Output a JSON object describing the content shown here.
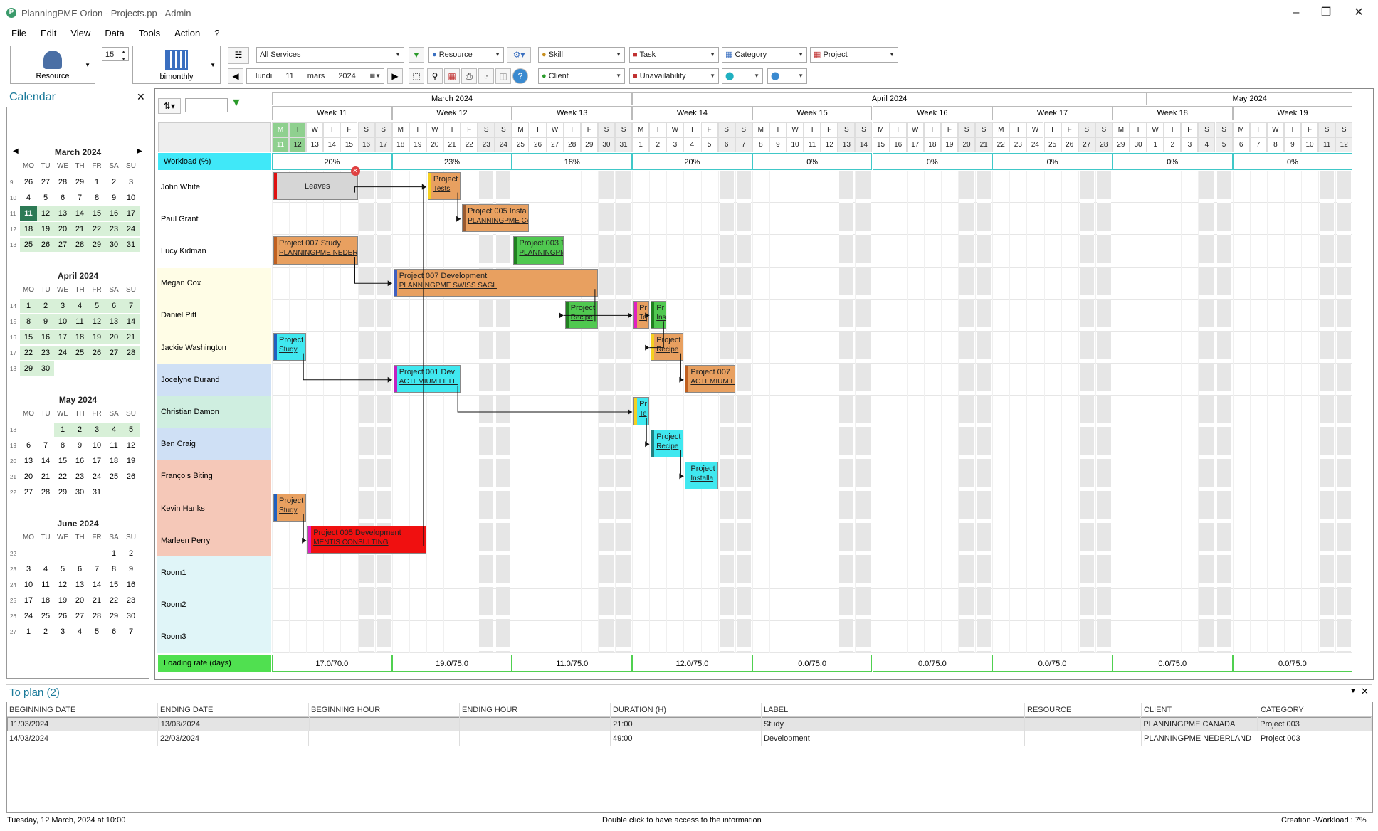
{
  "window": {
    "title": "PlanningPME Orion - Projects.pp - Admin"
  },
  "menu": [
    "File",
    "Edit",
    "View",
    "Data",
    "Tools",
    "Action",
    "?"
  ],
  "toolbar": {
    "resource_label": "Resource",
    "zoom_value": "15",
    "period_label": "bimonthly",
    "services": "All Services",
    "resource_filter": "Resource",
    "skill": "Skill",
    "task": "Task",
    "category": "Category",
    "project": "Project",
    "date_day": "lundi",
    "date_num": "11",
    "date_month": "mars",
    "date_year": "2024",
    "client": "Client",
    "unavailability": "Unavailability"
  },
  "calendar": {
    "title": "Calendar",
    "day_headers": [
      "MO",
      "TU",
      "WE",
      "TH",
      "FR",
      "SA",
      "SU"
    ],
    "months": [
      {
        "name": "March 2024",
        "weeks": [
          {
            "wk": "9",
            "days": [
              "26",
              "27",
              "28",
              "29",
              "1",
              "2",
              "3"
            ]
          },
          {
            "wk": "10",
            "days": [
              "4",
              "5",
              "6",
              "7",
              "8",
              "9",
              "10"
            ]
          },
          {
            "wk": "11",
            "days": [
              "11",
              "12",
              "13",
              "14",
              "15",
              "16",
              "17"
            ]
          },
          {
            "wk": "12",
            "days": [
              "18",
              "19",
              "20",
              "21",
              "22",
              "23",
              "24"
            ]
          },
          {
            "wk": "13",
            "days": [
              "25",
              "26",
              "27",
              "28",
              "29",
              "30",
              "31"
            ]
          }
        ]
      },
      {
        "name": "April 2024",
        "weeks": [
          {
            "wk": "14",
            "days": [
              "1",
              "2",
              "3",
              "4",
              "5",
              "6",
              "7"
            ]
          },
          {
            "wk": "15",
            "days": [
              "8",
              "9",
              "10",
              "11",
              "12",
              "13",
              "14"
            ]
          },
          {
            "wk": "16",
            "days": [
              "15",
              "16",
              "17",
              "18",
              "19",
              "20",
              "21"
            ]
          },
          {
            "wk": "17",
            "days": [
              "22",
              "23",
              "24",
              "25",
              "26",
              "27",
              "28"
            ]
          },
          {
            "wk": "18",
            "days": [
              "29",
              "30",
              "",
              "",
              "",
              "",
              ""
            ]
          }
        ]
      },
      {
        "name": "May 2024",
        "weeks": [
          {
            "wk": "18",
            "days": [
              "",
              "",
              "1",
              "2",
              "3",
              "4",
              "5"
            ]
          },
          {
            "wk": "19",
            "days": [
              "6",
              "7",
              "8",
              "9",
              "10",
              "11",
              "12"
            ]
          },
          {
            "wk": "20",
            "days": [
              "13",
              "14",
              "15",
              "16",
              "17",
              "18",
              "19"
            ]
          },
          {
            "wk": "21",
            "days": [
              "20",
              "21",
              "22",
              "23",
              "24",
              "25",
              "26"
            ]
          },
          {
            "wk": "22",
            "days": [
              "27",
              "28",
              "29",
              "30",
              "31",
              "",
              ""
            ]
          }
        ]
      },
      {
        "name": "June 2024",
        "weeks": [
          {
            "wk": "22",
            "days": [
              "",
              "",
              "",
              "",
              "",
              "1",
              "2"
            ]
          },
          {
            "wk": "23",
            "days": [
              "3",
              "4",
              "5",
              "6",
              "7",
              "8",
              "9"
            ]
          },
          {
            "wk": "24",
            "days": [
              "10",
              "11",
              "12",
              "13",
              "14",
              "15",
              "16"
            ]
          },
          {
            "wk": "25",
            "days": [
              "17",
              "18",
              "19",
              "20",
              "21",
              "22",
              "23"
            ]
          },
          {
            "wk": "26",
            "days": [
              "24",
              "25",
              "26",
              "27",
              "28",
              "29",
              "30"
            ]
          },
          {
            "wk": "27",
            "days": [
              "1",
              "2",
              "3",
              "4",
              "5",
              "6",
              "7"
            ]
          }
        ]
      }
    ]
  },
  "planner": {
    "months": [
      {
        "label": "March 2024",
        "start": 0,
        "span": 21
      },
      {
        "label": "April 2024",
        "start": 21,
        "span": 30
      },
      {
        "label": "May 2024",
        "start": 51,
        "span": 12
      }
    ],
    "weeks": [
      "Week 11",
      "Week 12",
      "Week 13",
      "Week 14",
      "Week 15",
      "Week 16",
      "Week 17",
      "Week 18",
      "Week 19"
    ],
    "day_letters": [
      "M",
      "T",
      "W",
      "T",
      "F",
      "S",
      "S"
    ],
    "day_numbers": [
      "11",
      "12",
      "13",
      "14",
      "15",
      "16",
      "17",
      "18",
      "19",
      "20",
      "21",
      "22",
      "23",
      "24",
      "25",
      "26",
      "27",
      "28",
      "29",
      "30",
      "31",
      "1",
      "2",
      "3",
      "4",
      "5",
      "6",
      "7",
      "8",
      "9",
      "10",
      "11",
      "12",
      "13",
      "14",
      "15",
      "16",
      "17",
      "18",
      "19",
      "20",
      "21",
      "22",
      "23",
      "24",
      "25",
      "26",
      "27",
      "28",
      "29",
      "30",
      "1",
      "2",
      "3",
      "4",
      "5",
      "6",
      "7",
      "8",
      "9",
      "10",
      "11",
      "12"
    ],
    "workload_label": "Workload (%)",
    "workload": [
      "20%",
      "23%",
      "18%",
      "20%",
      "0%",
      "0%",
      "0%",
      "0%",
      "0%"
    ],
    "loading_label": "Loading rate (days)",
    "loading": [
      "17.0/70.0",
      "19.0/75.0",
      "11.0/75.0",
      "12.0/75.0",
      "0.0/75.0",
      "0.0/75.0",
      "0.0/75.0",
      "0.0/75.0",
      "0.0/75.0"
    ],
    "resources": [
      {
        "name": "John White",
        "color": "#ffffff"
      },
      {
        "name": "Paul Grant",
        "color": "#ffffff"
      },
      {
        "name": "Lucy Kidman",
        "color": "#ffffff"
      },
      {
        "name": "Megan Cox",
        "color": "#fffde6"
      },
      {
        "name": "Daniel Pitt",
        "color": "#fffde6"
      },
      {
        "name": "Jackie Washington",
        "color": "#fffde6"
      },
      {
        "name": "Jocelyne Durand",
        "color": "#cfe0f5"
      },
      {
        "name": "Christian Damon",
        "color": "#cfeee0"
      },
      {
        "name": "Ben Craig",
        "color": "#cfe0f5"
      },
      {
        "name": "François Biting",
        "color": "#f5c8b8"
      },
      {
        "name": "Kevin Hanks",
        "color": "#f5c8b8"
      },
      {
        "name": "Marleen Perry",
        "color": "#f5c8b8"
      },
      {
        "name": "Room1",
        "color": "#e0f5f8"
      },
      {
        "name": "Room2",
        "color": "#e0f5f8"
      },
      {
        "name": "Room3",
        "color": "#e0f5f8"
      }
    ],
    "tasks": [
      {
        "row": 0,
        "start": 0,
        "days": 5,
        "label": "Leaves",
        "sub": "",
        "bg": "#d6d6d6",
        "bar": "#e01010"
      },
      {
        "row": 0,
        "start": 9,
        "days": 2,
        "label": "Project",
        "sub": "Tests",
        "bg": "#e8a060",
        "bar": "#f5d020"
      },
      {
        "row": 1,
        "start": 11,
        "days": 4,
        "label": "Project 005  Insta",
        "sub": "PLANNINGPME CA",
        "bg": "#e8a060",
        "bar": "#9a5a30"
      },
      {
        "row": 2,
        "start": 0,
        "days": 5,
        "label": "Project 007  Study",
        "sub": "PLANNINGPME NEDERL",
        "bg": "#e8a060",
        "bar": "#c06020"
      },
      {
        "row": 2,
        "start": 14,
        "days": 3,
        "label": "Project 003  T",
        "sub": "PLANNINGPME",
        "bg": "#50c850",
        "bar": "#208020"
      },
      {
        "row": 3,
        "start": 7,
        "days": 12,
        "label": "Project 007  Development",
        "sub": "PLANNINGPME SWISS SAGL",
        "bg": "#e8a060",
        "bar": "#4060c0"
      },
      {
        "row": 4,
        "start": 17,
        "days": 2,
        "label": "Project (",
        "sub": "Recipe",
        "bg": "#50c850",
        "bar": "#208020"
      },
      {
        "row": 4,
        "start": 21,
        "days": 1,
        "label": "Pr",
        "sub": "Te",
        "bg": "#e8a060",
        "bar": "#e020c0"
      },
      {
        "row": 4,
        "start": 22,
        "days": 1,
        "label": "Pr",
        "sub": "Ins",
        "bg": "#50c850",
        "bar": "#208020"
      },
      {
        "row": 5,
        "start": 0,
        "days": 2,
        "label": "Project",
        "sub": "Study",
        "bg": "#40e8f0",
        "bar": "#2060c0"
      },
      {
        "row": 5,
        "start": 22,
        "days": 2,
        "label": "Project",
        "sub": "Recipe",
        "bg": "#e8a060",
        "bar": "#f5d020"
      },
      {
        "row": 6,
        "start": 7,
        "days": 4,
        "label": "Project 001  Dev",
        "sub": "ACTEMIUM LILLE",
        "bg": "#40e8f0",
        "bar": "#c020c0"
      },
      {
        "row": 6,
        "start": 24,
        "days": 3,
        "label": "Project 007",
        "sub": "ACTEMIUM L",
        "bg": "#e8a060",
        "bar": "#c06020"
      },
      {
        "row": 7,
        "start": 21,
        "days": 1,
        "label": "Pr",
        "sub": "Te",
        "bg": "#40e8f0",
        "bar": "#f5d020"
      },
      {
        "row": 8,
        "start": 22,
        "days": 2,
        "label": "Project",
        "sub": "Recipe",
        "bg": "#40e8f0",
        "bar": "#208080"
      },
      {
        "row": 9,
        "start": 24,
        "days": 2,
        "label": "Project",
        "sub": "Installa",
        "bg": "#40e8f0",
        "bar": "#40e8f0"
      },
      {
        "row": 10,
        "start": 0,
        "days": 2,
        "label": "Project",
        "sub": "Study",
        "bg": "#e8a060",
        "bar": "#2060c0"
      },
      {
        "row": 11,
        "start": 2,
        "days": 7,
        "label": "Project 005  Development",
        "sub": "MENTIS CONSULTING",
        "bg": "#f01010",
        "bar": "#e020c0"
      }
    ]
  },
  "to_plan": {
    "title": "To plan (2)",
    "columns": [
      "BEGINNING DATE",
      "ENDING DATE",
      "BEGINNING HOUR",
      "ENDING HOUR",
      "DURATION (H)",
      "LABEL",
      "RESOURCE",
      "CLIENT",
      "CATEGORY"
    ],
    "rows": [
      [
        "11/03/2024",
        "13/03/2024",
        "",
        "",
        "21:00",
        "Study",
        "",
        "PLANNINGPME CANADA",
        "Project 003"
      ],
      [
        "14/03/2024",
        "22/03/2024",
        "",
        "",
        "49:00",
        "Development",
        "",
        "PLANNINGPME NEDERLAND",
        "Project 003"
      ]
    ]
  },
  "status": {
    "left": "Tuesday, 12 March, 2024 at 10:00",
    "center": "Double click to have access to the information",
    "right": "Creation -Workload : 7%"
  }
}
